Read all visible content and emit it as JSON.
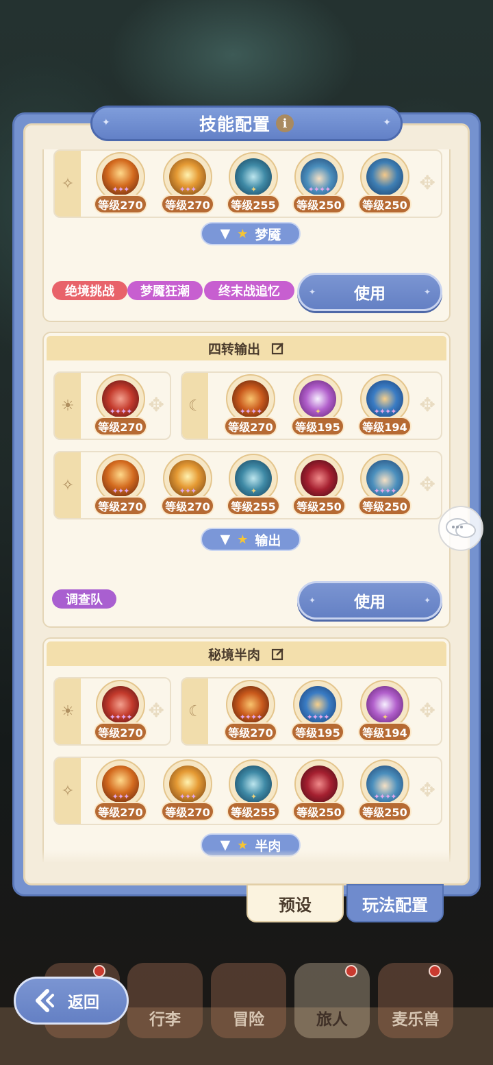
{
  "window": {
    "title": "技能配置"
  },
  "cards": [
    {
      "rows": [
        {
          "kind": "mixed",
          "levels": [
            "等级270",
            "等级270",
            "等级255",
            "等级250",
            "等级250"
          ]
        }
      ],
      "team_tag": "梦魇",
      "modes": [
        "绝境挑战",
        "梦魇狂潮",
        "终末战追忆"
      ],
      "use_label": "使用"
    },
    {
      "title": "四转输出",
      "sun_levels": [
        "等级270"
      ],
      "moon_levels": [
        "等级270",
        "等级195",
        "等级194"
      ],
      "star_levels": [
        "等级270",
        "等级270",
        "等级255",
        "等级250",
        "等级250"
      ],
      "team_tag": "输出",
      "modes": [
        "调查队"
      ],
      "use_label": "使用"
    },
    {
      "title": "秘境半肉",
      "sun_levels": [
        "等级270"
      ],
      "moon_levels": [
        "等级270",
        "等级195",
        "等级194"
      ],
      "star_levels": [
        "等级270",
        "等级270",
        "等级255",
        "等级250",
        "等级250"
      ],
      "team_tag": "半肉"
    }
  ],
  "bottom_tabs": {
    "preset": "预设",
    "gameplay": "玩法配置"
  },
  "nav": {
    "back": "返回",
    "items": [
      "行李",
      "冒险",
      "旅人",
      "麦乐兽"
    ]
  },
  "colors": {
    "accent": "#6f8bcd",
    "level_badge": "#b66a33",
    "mode_red": "#e8636a",
    "mode_purple": "#c75fd0"
  }
}
